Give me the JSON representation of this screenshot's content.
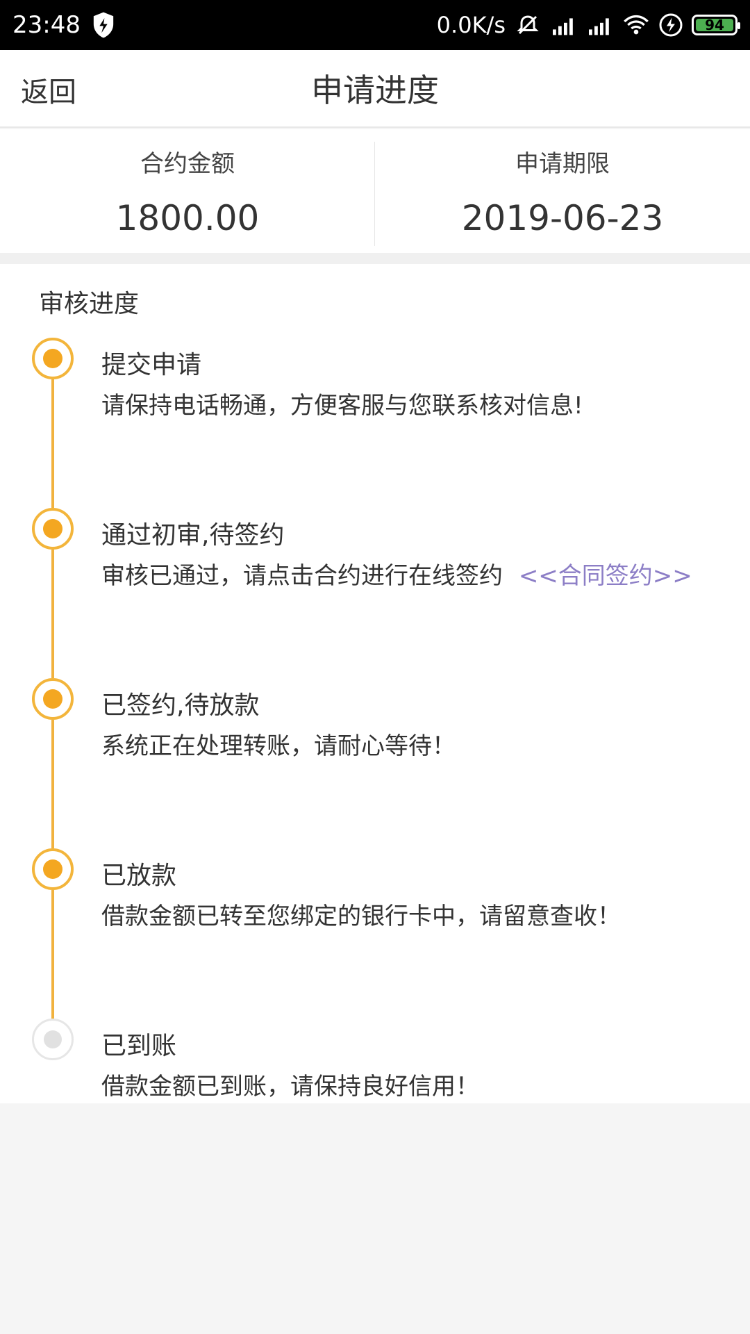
{
  "status_bar": {
    "time": "23:48",
    "net_speed": "0.0K/s",
    "battery": "94",
    "icons": [
      "shield-icon",
      "mute-icon",
      "signal-icon",
      "signal-icon",
      "wifi-icon",
      "charging-icon",
      "battery-icon"
    ]
  },
  "header": {
    "back_label": "返回",
    "title": "申请进度"
  },
  "summary": {
    "amount_label": "合约金额",
    "amount_value": "1800.00",
    "deadline_label": "申请期限",
    "deadline_value": "2019-06-23"
  },
  "progress": {
    "title": "审核进度",
    "steps": [
      {
        "title": "提交申请",
        "desc": "请保持电话畅通，方便客服与您联系核对信息!",
        "done": true
      },
      {
        "title": "通过初审,待签约",
        "desc": "审核已通过，请点击合约进行在线签约",
        "link": "<<合同签约>>",
        "done": true
      },
      {
        "title": "已签约,待放款",
        "desc": "系统正在处理转账，请耐心等待！",
        "done": true
      },
      {
        "title": "已放款",
        "desc": "借款金额已转至您绑定的银行卡中，请留意查收！",
        "done": true
      },
      {
        "title": "已到账",
        "desc": "借款金额已到账，请保持良好信用！",
        "done": false
      }
    ]
  },
  "colors": {
    "accent": "#f4a721",
    "line": "#f1b23e",
    "link": "#8c7ec6"
  }
}
